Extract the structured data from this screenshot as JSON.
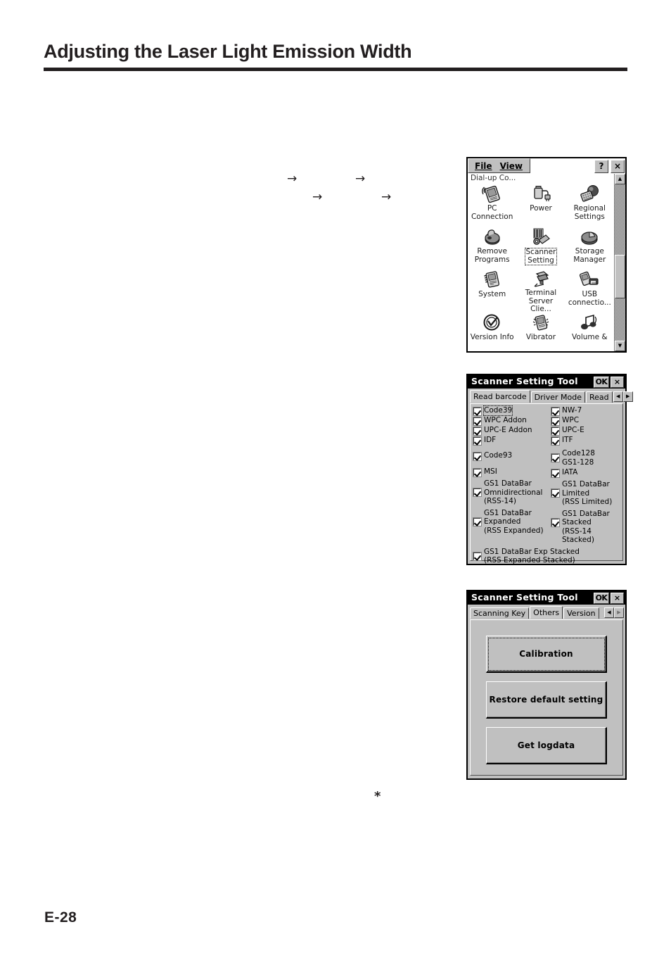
{
  "page": {
    "title": "Adjusting the Laser Light Emission Width",
    "number": "E-28",
    "footnote_marker": "*"
  },
  "arrows": [
    {
      "glyph": "→"
    },
    {
      "glyph": "→"
    },
    {
      "glyph": "→"
    },
    {
      "glyph": "→"
    }
  ],
  "control_panel": {
    "menu": {
      "file": "File",
      "view": "View",
      "help_label": "?",
      "close_label": "×"
    },
    "clipped_top_item": "Dial-up Co...",
    "items": [
      {
        "label": "PC\nConnection",
        "icon": "pc-connection-icon",
        "selected": false
      },
      {
        "label": "Power",
        "icon": "power-icon",
        "selected": false
      },
      {
        "label": "Regional\nSettings",
        "icon": "regional-settings-icon",
        "selected": false
      },
      {
        "label": "Remove\nPrograms",
        "icon": "remove-programs-icon",
        "selected": false
      },
      {
        "label": "Scanner\nSetting",
        "icon": "scanner-setting-icon",
        "selected": true
      },
      {
        "label": "Storage\nManager",
        "icon": "storage-manager-icon",
        "selected": false
      },
      {
        "label": "System",
        "icon": "system-icon",
        "selected": false
      },
      {
        "label": "Terminal\nServer Clie...",
        "icon": "terminal-server-client-icon",
        "selected": false
      },
      {
        "label": "USB\nconnectio...",
        "icon": "usb-connection-icon",
        "selected": false
      },
      {
        "label": "Version Info",
        "icon": "version-info-icon",
        "selected": false
      },
      {
        "label": "Vibrator",
        "icon": "vibrator-icon",
        "selected": false
      },
      {
        "label": "Volume &",
        "icon": "volume-and-sounds-icon",
        "selected": false
      }
    ],
    "scrollbar": {
      "up_glyph": "▲",
      "down_glyph": "▼"
    }
  },
  "scanner_read": {
    "title": "Scanner Setting Tool",
    "ok_label": "OK",
    "close_label": "×",
    "tabs": [
      {
        "label": "Read barcode",
        "active": true
      },
      {
        "label": "Driver Mode",
        "active": false
      },
      {
        "label": "Read",
        "active": false
      }
    ],
    "tab_scroll": {
      "left": "◀",
      "right": "▶"
    },
    "rows": [
      {
        "left": {
          "label": "Code39",
          "checked": true,
          "focused": true
        },
        "right": {
          "label": "NW-7",
          "checked": true
        }
      },
      {
        "left": {
          "label": "WPC Addon",
          "checked": true
        },
        "right": {
          "label": "WPC",
          "checked": true
        }
      },
      {
        "left": {
          "label": "UPC-E Addon",
          "checked": true
        },
        "right": {
          "label": "UPC-E",
          "checked": true
        }
      },
      {
        "left": {
          "label": "IDF",
          "checked": true
        },
        "right": {
          "label": "ITF",
          "checked": true
        }
      },
      {
        "left": {
          "label": "Code93",
          "checked": true
        },
        "right": {
          "label": "Code128\nGS1-128",
          "checked": true
        }
      },
      {
        "left": {
          "label": "MSI",
          "checked": true
        },
        "right": {
          "label": "IATA",
          "checked": true
        }
      },
      {
        "left": {
          "label": "GS1 DataBar\nOmnidirectional\n(RSS-14)",
          "checked": true
        },
        "right": {
          "label": "GS1 DataBar\nLimited\n(RSS Limited)",
          "checked": true
        }
      },
      {
        "left": {
          "label": "GS1 DataBar\nExpanded\n(RSS Expanded)",
          "checked": true
        },
        "right": {
          "label": "GS1 DataBar\nStacked\n(RSS-14 Stacked)",
          "checked": true
        }
      }
    ],
    "last_row": {
      "label": "GS1 DataBar Exp Stacked\n(RSS Expanded Stacked)",
      "checked": true
    }
  },
  "scanner_others": {
    "title": "Scanner Setting Tool",
    "ok_label": "OK",
    "close_label": "×",
    "tabs": [
      {
        "label": "Scanning Key",
        "active": false
      },
      {
        "label": "Others",
        "active": true
      },
      {
        "label": "Version",
        "active": false
      }
    ],
    "tab_scroll": {
      "left": "◀",
      "right": "▶"
    },
    "buttons": [
      {
        "label": "Calibration",
        "focused": true
      },
      {
        "label": "Restore default setting",
        "focused": false
      },
      {
        "label": "Get logdata",
        "focused": false
      }
    ]
  },
  "colors": {
    "ink": "#231f20",
    "window_face": "#c0c0c0",
    "titlebar": "#000000",
    "paper": "#ffffff"
  }
}
